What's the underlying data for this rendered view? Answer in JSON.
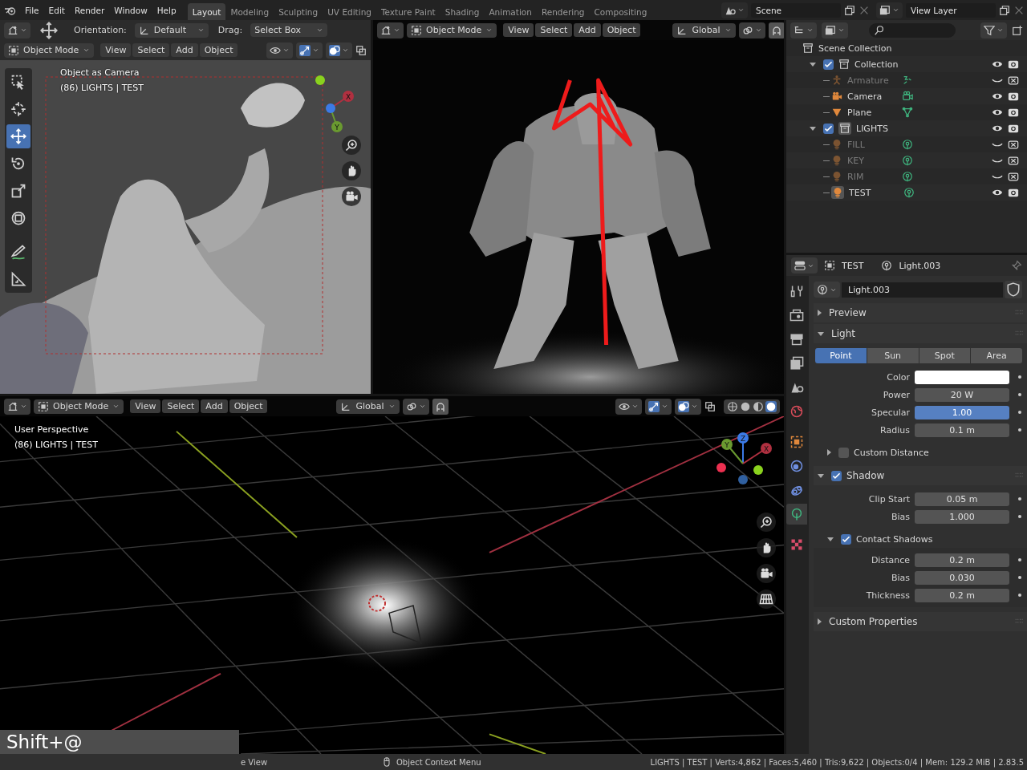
{
  "top_bar": {
    "menus": [
      "File",
      "Edit",
      "Render",
      "Window",
      "Help"
    ],
    "workspaces": [
      {
        "label": "Layout",
        "selected": true
      },
      {
        "label": "Modeling",
        "selected": false
      },
      {
        "label": "Sculpting",
        "selected": false
      },
      {
        "label": "UV Editing",
        "selected": false
      },
      {
        "label": "Texture Paint",
        "selected": false
      },
      {
        "label": "Shading",
        "selected": false
      },
      {
        "label": "Animation",
        "selected": false
      },
      {
        "label": "Rendering",
        "selected": false
      },
      {
        "label": "Compositing",
        "selected": false
      }
    ],
    "scene": "Scene",
    "view_layer": "View Layer"
  },
  "viewport_camera": {
    "tool_header": {
      "orientation_label": "Orientation:",
      "orientation": "Default",
      "drag_label": "Drag:",
      "drag": "Select Box"
    },
    "mode": "Object Mode",
    "menus": [
      "View",
      "Select",
      "Add",
      "Object"
    ],
    "overlay_text": [
      "Object as Camera",
      "(86) LIGHTS | TEST"
    ],
    "gizmo_axes": [
      "X",
      "Y"
    ],
    "tools": [
      {
        "kind": "select",
        "selected": false
      },
      {
        "kind": "cursor",
        "selected": false
      },
      {
        "kind": "move",
        "selected": true
      },
      {
        "kind": "rotate",
        "selected": false
      },
      {
        "kind": "scale",
        "selected": false
      },
      {
        "kind": "transform",
        "selected": false
      },
      {
        "kind": "annotate",
        "selected": false
      },
      {
        "kind": "measure",
        "selected": false
      }
    ]
  },
  "viewport_render": {
    "mode": "Object Mode",
    "menus": [
      "View",
      "Select",
      "Add",
      "Object"
    ],
    "orientation": "Global"
  },
  "viewport_perspective": {
    "mode": "Object Mode",
    "menus": [
      "View",
      "Select",
      "Add",
      "Object"
    ],
    "orientation": "Global",
    "overlay_text": [
      "User Perspective",
      "(86) LIGHTS | TEST"
    ],
    "gizmo_axes": [
      "Y",
      "Z",
      "X"
    ],
    "shading": [
      {
        "selected": false
      },
      {
        "selected": false
      },
      {
        "selected": false
      },
      {
        "selected": true
      }
    ]
  },
  "outliner": {
    "root": "Scene Collection",
    "collections": [
      {
        "name": "Collection",
        "checked": true,
        "expanded": true,
        "active": false,
        "objects": [
          {
            "name": "Armature",
            "kind": "armature",
            "visible": false,
            "active": false
          },
          {
            "name": "Camera",
            "kind": "camera",
            "visible": true,
            "active": false
          },
          {
            "name": "Plane",
            "kind": "mesh",
            "visible": true,
            "active": false
          }
        ]
      },
      {
        "name": "LIGHTS",
        "checked": true,
        "expanded": true,
        "active": true,
        "objects": [
          {
            "name": "FILL",
            "kind": "light",
            "visible": false,
            "active": false
          },
          {
            "name": "KEY",
            "kind": "light",
            "visible": false,
            "active": false
          },
          {
            "name": "RIM",
            "kind": "light",
            "visible": false,
            "active": false
          },
          {
            "name": "TEST",
            "kind": "light",
            "visible": true,
            "active": true
          }
        ]
      }
    ]
  },
  "properties": {
    "object": "TEST",
    "data": "Light.003",
    "datablock": "Light.003",
    "tabs": [
      {
        "kind": "tool",
        "selected": false
      },
      {
        "kind": "render",
        "selected": false
      },
      {
        "kind": "output",
        "selected": false
      },
      {
        "kind": "view_layer",
        "selected": false
      },
      {
        "kind": "scene",
        "selected": false
      },
      {
        "kind": "world",
        "selected": false
      },
      {
        "kind": "object",
        "selected": false
      },
      {
        "kind": "physics",
        "selected": false
      },
      {
        "kind": "constraints",
        "selected": false
      },
      {
        "kind": "light",
        "selected": true
      },
      {
        "kind": "texture",
        "selected": false
      }
    ],
    "panels": [
      {
        "title": "Preview",
        "expanded": false
      },
      {
        "title": "Light",
        "expanded": true,
        "light_types": [
          {
            "label": "Point",
            "selected": true
          },
          {
            "label": "Sun",
            "selected": false
          },
          {
            "label": "Spot",
            "selected": false
          },
          {
            "label": "Area",
            "selected": false
          }
        ],
        "fields": [
          {
            "label": "Color",
            "kind": "color",
            "color": "#ffffff"
          },
          {
            "label": "Power",
            "kind": "number",
            "value": "20 W",
            "active": false
          },
          {
            "label": "Specular",
            "kind": "number",
            "value": "1.00",
            "active": true
          },
          {
            "label": "Radius",
            "kind": "number",
            "value": "0.1 m",
            "active": false
          }
        ],
        "subpanels": [
          {
            "title": "Custom Distance",
            "expanded": false,
            "checked": false
          }
        ]
      },
      {
        "title": "Shadow",
        "expanded": true,
        "checked": true,
        "fields": [
          {
            "label": "Clip Start",
            "kind": "number",
            "value": "0.05 m",
            "active": false
          },
          {
            "label": "Bias",
            "kind": "number",
            "value": "1.000",
            "active": false
          }
        ],
        "subpanels": [
          {
            "title": "Contact Shadows",
            "expanded": true,
            "checked": true,
            "fields": [
              {
                "label": "Distance",
                "kind": "number",
                "value": "0.2 m",
                "active": false
              },
              {
                "label": "Bias",
                "kind": "number",
                "value": "0.030",
                "active": false
              },
              {
                "label": "Thickness",
                "kind": "number",
                "value": "0.2 m",
                "active": false
              }
            ]
          }
        ]
      },
      {
        "title": "Custom Properties",
        "expanded": false
      }
    ]
  },
  "key_overlay": "Shift+@",
  "status_bar": {
    "hints": [
      "e View",
      "Object Context Menu"
    ],
    "stats": "LIGHTS | TEST | Verts:4,862 | Faces:5,460 | Tris:9,622 | Objects:0/4 | Mem: 129.2 MiB | 2.83.5"
  }
}
